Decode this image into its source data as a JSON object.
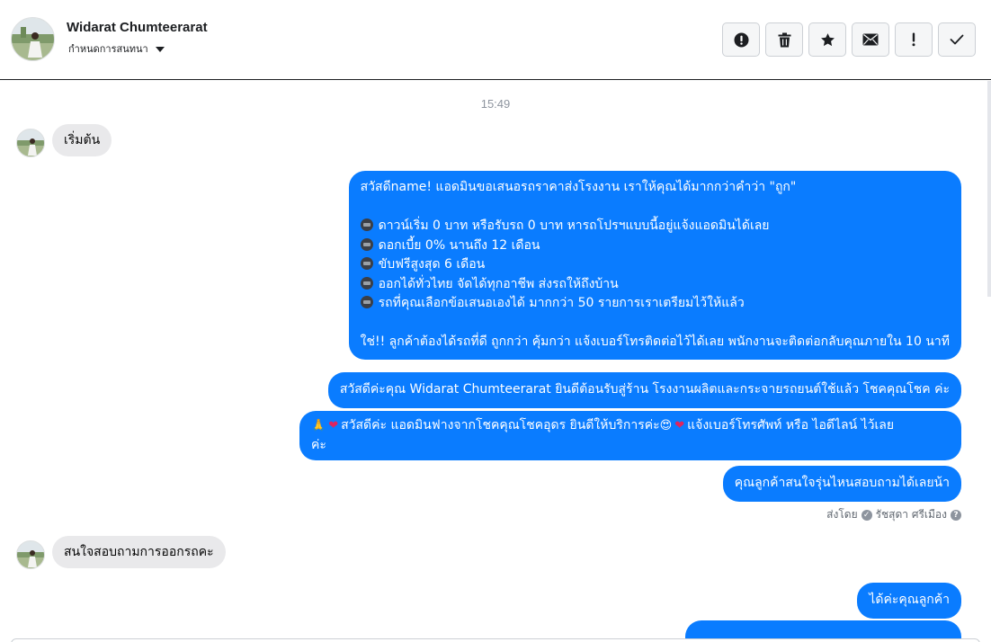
{
  "header": {
    "contact_name": "Widarat Chumteerarat",
    "subtitle": "กำหนดการสนทนา",
    "avatar_icon": "profile-photo",
    "actions": [
      {
        "name": "report-spam-button",
        "icon": "alert-circle-icon"
      },
      {
        "name": "delete-button",
        "icon": "trash-icon"
      },
      {
        "name": "star-button",
        "icon": "star-icon"
      },
      {
        "name": "mark-unread-button",
        "icon": "envelope-icon"
      },
      {
        "name": "important-button",
        "icon": "exclamation-icon"
      },
      {
        "name": "mark-done-button",
        "icon": "check-icon"
      }
    ]
  },
  "conversation": {
    "timestamp": "15:49",
    "messages": [
      {
        "from": "customer",
        "text": "เริ่มต้น"
      },
      {
        "from": "page",
        "lines": [
          "สวัสดีname! แอดมินขอเสนอรถราคาส่งโรงงาน เราให้คุณได้มากกว่าคำว่า \"ถูก\"",
          "",
          "ดาวน์เริ่ม 0 บาท หรือรับรถ 0 บาท หารถโปรฯแบบนี้อยู่แจ้งแอดมินได้เลย",
          "ดอกเบี้ย 0% นานถึง 12 เดือน",
          "ขับฟรีสูงสุด 6 เดือน",
          "ออกได้ทั่วไทย จัดได้ทุกอาชีพ ส่งรถให้ถึงบ้าน",
          "รถที่คุณเลือกข้อเสนอเองได้ มากกว่า 50 รายการเราเตรียมไว้ให้แล้ว",
          "",
          "ใช่!! ลูกค้าต้องได้รถที่ดี ถูกกว่า คุ้มกว่า แจ้งเบอร์โทรติดต่อไว้ได้เลย พนักงานจะติดต่อกลับคุณภายใน 10 นาที"
        ]
      },
      {
        "from": "page",
        "text": "สวัสดีค่ะคุณ Widarat Chumteerarat ยินดีต้อนรับสู่ร้าน โรงงานผลิตและกระจายรถยนต์ใช้แล้ว โชคคุณโชค ค่ะ"
      },
      {
        "from": "page",
        "lines": [
          "สวัสดีค่ะ แอดมินฟางจากโชคคุณโชคอุดร ยินดีให้บริการค่ะ",
          "แจ้งเบอร์โทรศัพท์ หรือ ไอดีไลน์  ไว้เลย",
          "ค่ะ"
        ]
      },
      {
        "from": "page",
        "text": "คุณลูกค้าสนใจรุ่นไหนสอบถามได้เลยน้า"
      },
      {
        "from": "customer",
        "text": "สนใจสอบถามการออกรถคะ"
      },
      {
        "from": "page",
        "text": "ได้ค่ะคุณลูกค้า"
      }
    ],
    "sent_by": {
      "prefix": "ส่งโดย",
      "agent": "รัชสุดา ศรีเมือง",
      "help_icon": "question-circle-icon",
      "agent_icon": "check-circle-icon"
    }
  },
  "colors": {
    "outgoing_bubble": "#0a7cff",
    "incoming_bubble": "#e9e9eb",
    "toolbar_button_bg": "#f5f6f7",
    "timestamp_text": "#8d949e"
  }
}
